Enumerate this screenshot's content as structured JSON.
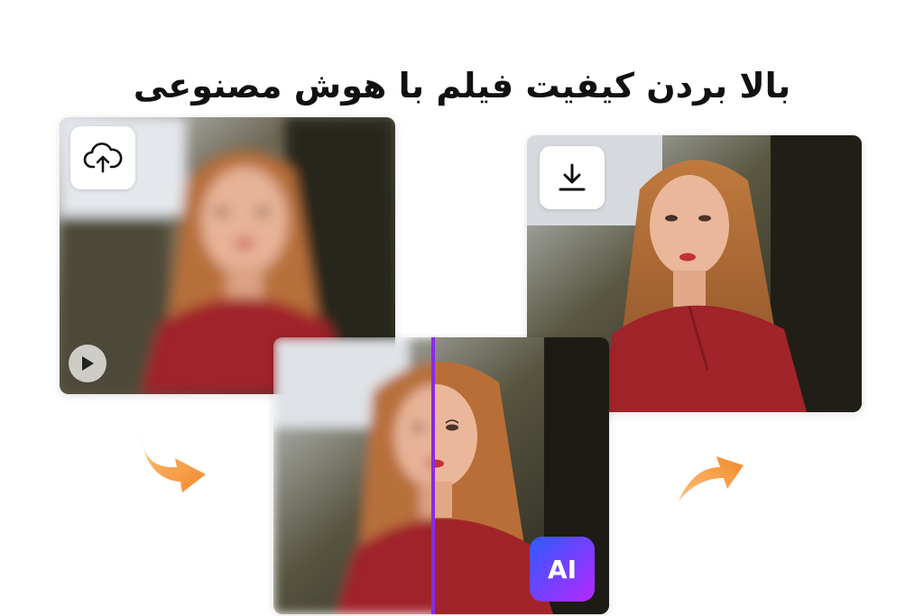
{
  "title": "بالا بردن کیفیت فیلم با هوش مصنوعی",
  "badge": {
    "label": "AI"
  },
  "colors": {
    "arrow": "#f39a3d",
    "divider": "#8a2be2",
    "badge_start": "#2f5bff",
    "badge_end": "#b527ff",
    "shirt": "#a0242a",
    "hair": "#b8703a"
  },
  "icons": {
    "upload": "cloud-upload-icon",
    "download": "download-icon",
    "play": "play-icon"
  }
}
